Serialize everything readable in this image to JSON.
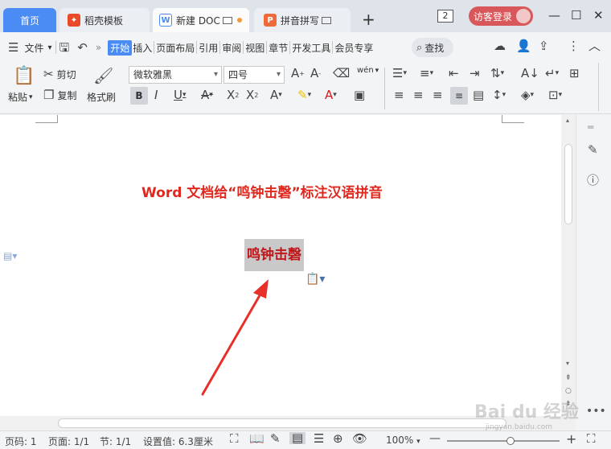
{
  "tabs": {
    "home": "首页",
    "template": "稻壳模板",
    "doc": "新建 DOC",
    "pinyin": "拼音拼写"
  },
  "titlebar": {
    "window_count": "2",
    "visitor_login": "访客登录"
  },
  "menu": {
    "file": "文件",
    "items": [
      "开始",
      "插入",
      "页面布局",
      "引用",
      "审阅",
      "视图",
      "章节",
      "开发工具",
      "会员专享"
    ],
    "search": "查找"
  },
  "ribbon": {
    "paste": "粘贴",
    "cut": "剪切",
    "copy": "复制",
    "format_painter": "格式刷",
    "font_name": "微软雅黑",
    "font_size": "四号",
    "wen": "wén"
  },
  "document": {
    "title": "Word  文档给“鸣钟击磬”标注汉语拼音",
    "selected_text": "鸣钟击磬"
  },
  "status": {
    "page_num": "页码: 1",
    "page_total": "页面: 1/1",
    "section": "节: 1/1",
    "setting": "设置值: 6.3厘米",
    "zoom": "100%",
    "zoom_fraction": 0.5
  },
  "watermark": "Bai du 经验",
  "watermark_url": "jingyan.baidu.com",
  "colors": {
    "accent": "#4b8bf4",
    "title_red": "#e0281e",
    "visitor": "#d8575a"
  }
}
